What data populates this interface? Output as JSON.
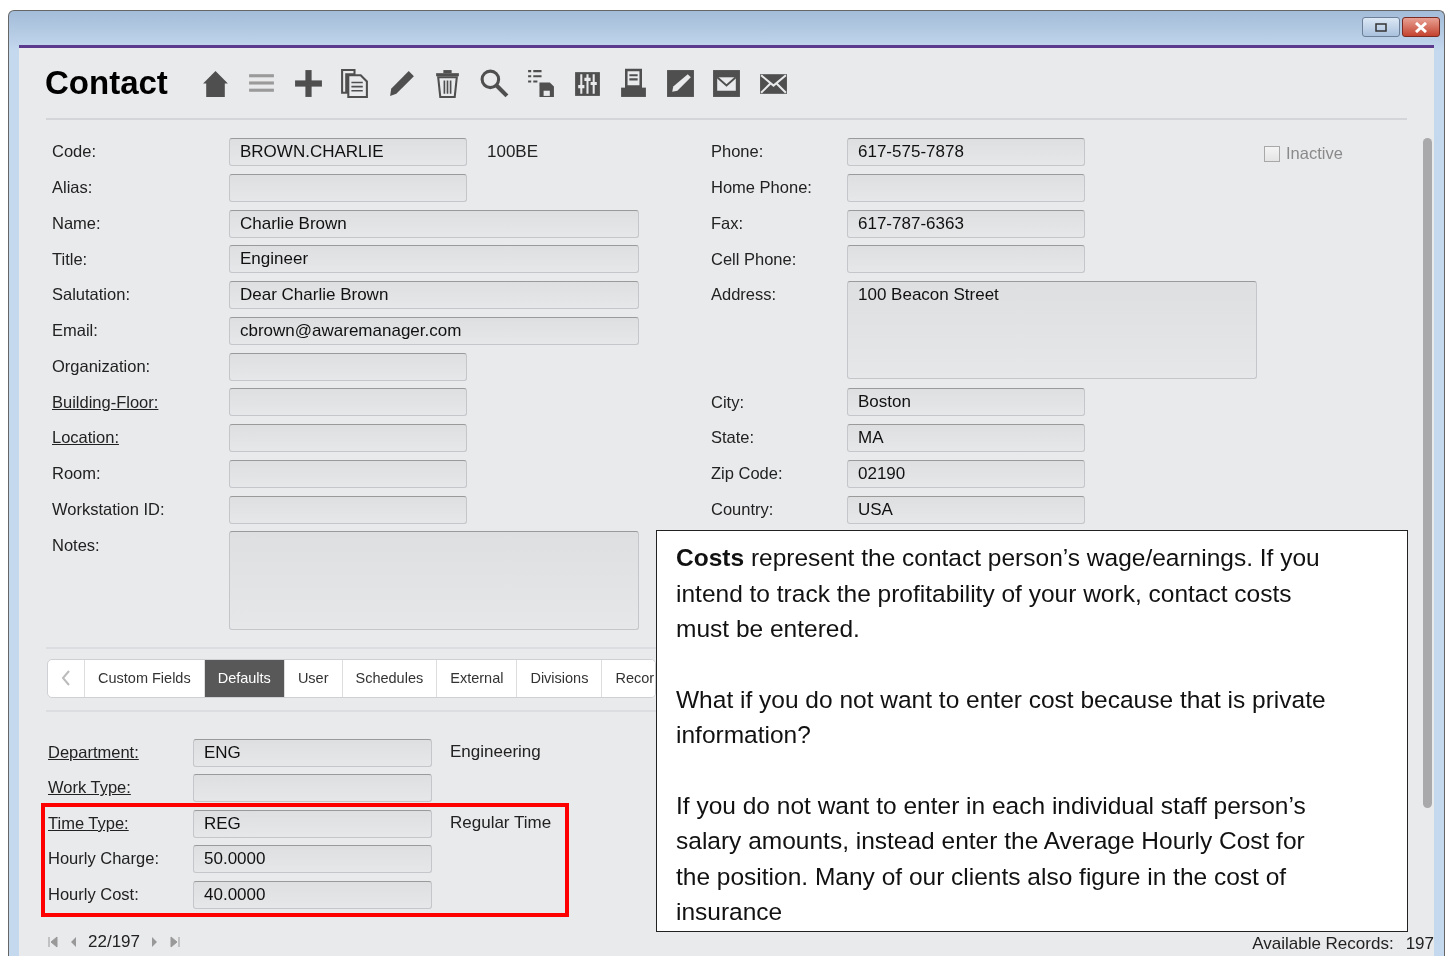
{
  "window": {
    "title": "Contact",
    "buttons": [
      {
        "kind": "restore"
      },
      {
        "kind": "close"
      }
    ]
  },
  "toolbar": [
    {
      "kind": "home",
      "disabled": false
    },
    {
      "kind": "list",
      "disabled": true
    },
    {
      "kind": "add",
      "disabled": false
    },
    {
      "kind": "copy",
      "disabled": false
    },
    {
      "kind": "pencil",
      "disabled": false
    },
    {
      "kind": "trash",
      "disabled": false
    },
    {
      "kind": "search",
      "disabled": false
    },
    {
      "kind": "listdisk",
      "disabled": false
    },
    {
      "kind": "sliders",
      "disabled": false
    },
    {
      "kind": "printer",
      "disabled": false
    },
    {
      "kind": "editbox",
      "disabled": false
    },
    {
      "kind": "mailbox",
      "disabled": false
    },
    {
      "kind": "mail",
      "disabled": false
    }
  ],
  "left_fields": [
    {
      "label": "Code:",
      "link": false,
      "kind": "short",
      "value": "BROWN.CHARLIE",
      "note": "100BE"
    },
    {
      "label": "Alias:",
      "link": false,
      "kind": "short"
    },
    {
      "label": "Name:",
      "link": false,
      "kind": "wide",
      "value": "Charlie Brown"
    },
    {
      "label": "Title:",
      "link": false,
      "kind": "wide",
      "value": "Engineer"
    },
    {
      "label": "Salutation:",
      "link": false,
      "kind": "wide",
      "value": "Dear Charlie Brown"
    },
    {
      "label": "Email:",
      "link": false,
      "kind": "wide",
      "value": "cbrown@awaremanager.com"
    },
    {
      "label": "Organization:",
      "link": false,
      "kind": "short"
    },
    {
      "label": "Building-Floor:",
      "link": true,
      "kind": "short"
    },
    {
      "label": "Location:",
      "link": true,
      "kind": "short"
    },
    {
      "label": "Room:",
      "link": false,
      "kind": "short"
    },
    {
      "label": "Workstation ID:",
      "link": false,
      "kind": "short"
    },
    {
      "label": "Notes:",
      "link": false,
      "kind": "area"
    }
  ],
  "right_fields": [
    {
      "label": "Phone:",
      "link": false,
      "kind": "short",
      "value": "617-575-7878"
    },
    {
      "label": "Home Phone:",
      "link": false,
      "kind": "short"
    },
    {
      "label": "Fax:",
      "link": false,
      "kind": "short",
      "value": "617-787-6363"
    },
    {
      "label": "Cell Phone:",
      "link": false,
      "kind": "short"
    },
    {
      "label": "Address:",
      "link": false,
      "kind": "address",
      "value": "100 Beacon Street"
    },
    {
      "label": "City:",
      "link": false,
      "kind": "short",
      "value": "Boston"
    },
    {
      "label": "State:",
      "link": false,
      "kind": "short",
      "value": "MA"
    },
    {
      "label": "Zip Code:",
      "link": false,
      "kind": "short",
      "value": "02190"
    },
    {
      "label": "Country:",
      "link": false,
      "kind": "short",
      "value": "USA"
    }
  ],
  "inactive": {
    "label": "Inactive",
    "checked": false
  },
  "tabs": [
    {
      "label": "Custom Fields",
      "selected": false
    },
    {
      "label": "Defaults",
      "selected": true
    },
    {
      "label": "User",
      "selected": false
    },
    {
      "label": "Schedules",
      "selected": false
    },
    {
      "label": "External",
      "selected": false
    },
    {
      "label": "Divisions",
      "selected": false
    },
    {
      "label": "Recor",
      "selected": false
    }
  ],
  "defaults_fields": [
    {
      "label": "Department:",
      "link": true,
      "value": "ENG",
      "note": "Engineering"
    },
    {
      "label": "Work Type:",
      "link": true
    }
  ],
  "highlighted_fields": [
    {
      "label": "Time Type:",
      "link": true,
      "value": "REG",
      "note": "Regular Time"
    },
    {
      "label": "Hourly Charge:",
      "link": false,
      "value": "50.0000"
    },
    {
      "label": "Hourly Cost:",
      "link": false,
      "value": "40.0000"
    }
  ],
  "pager": {
    "position": "22/197"
  },
  "status": {
    "label": "Available Records:",
    "count": "197"
  },
  "callout": {
    "paragraphs": [
      "**Costs** represent the contact person’s wage/earnings. If you intend to track the profitability of your work, contact costs must be entered.",
      "What if you do not want to enter cost because that is private information?",
      "If you do not want to enter in each individual staff person’s salary amounts, instead enter the Average Hourly Cost for the position. Many of our clients also figure in the cost of insurance"
    ]
  }
}
